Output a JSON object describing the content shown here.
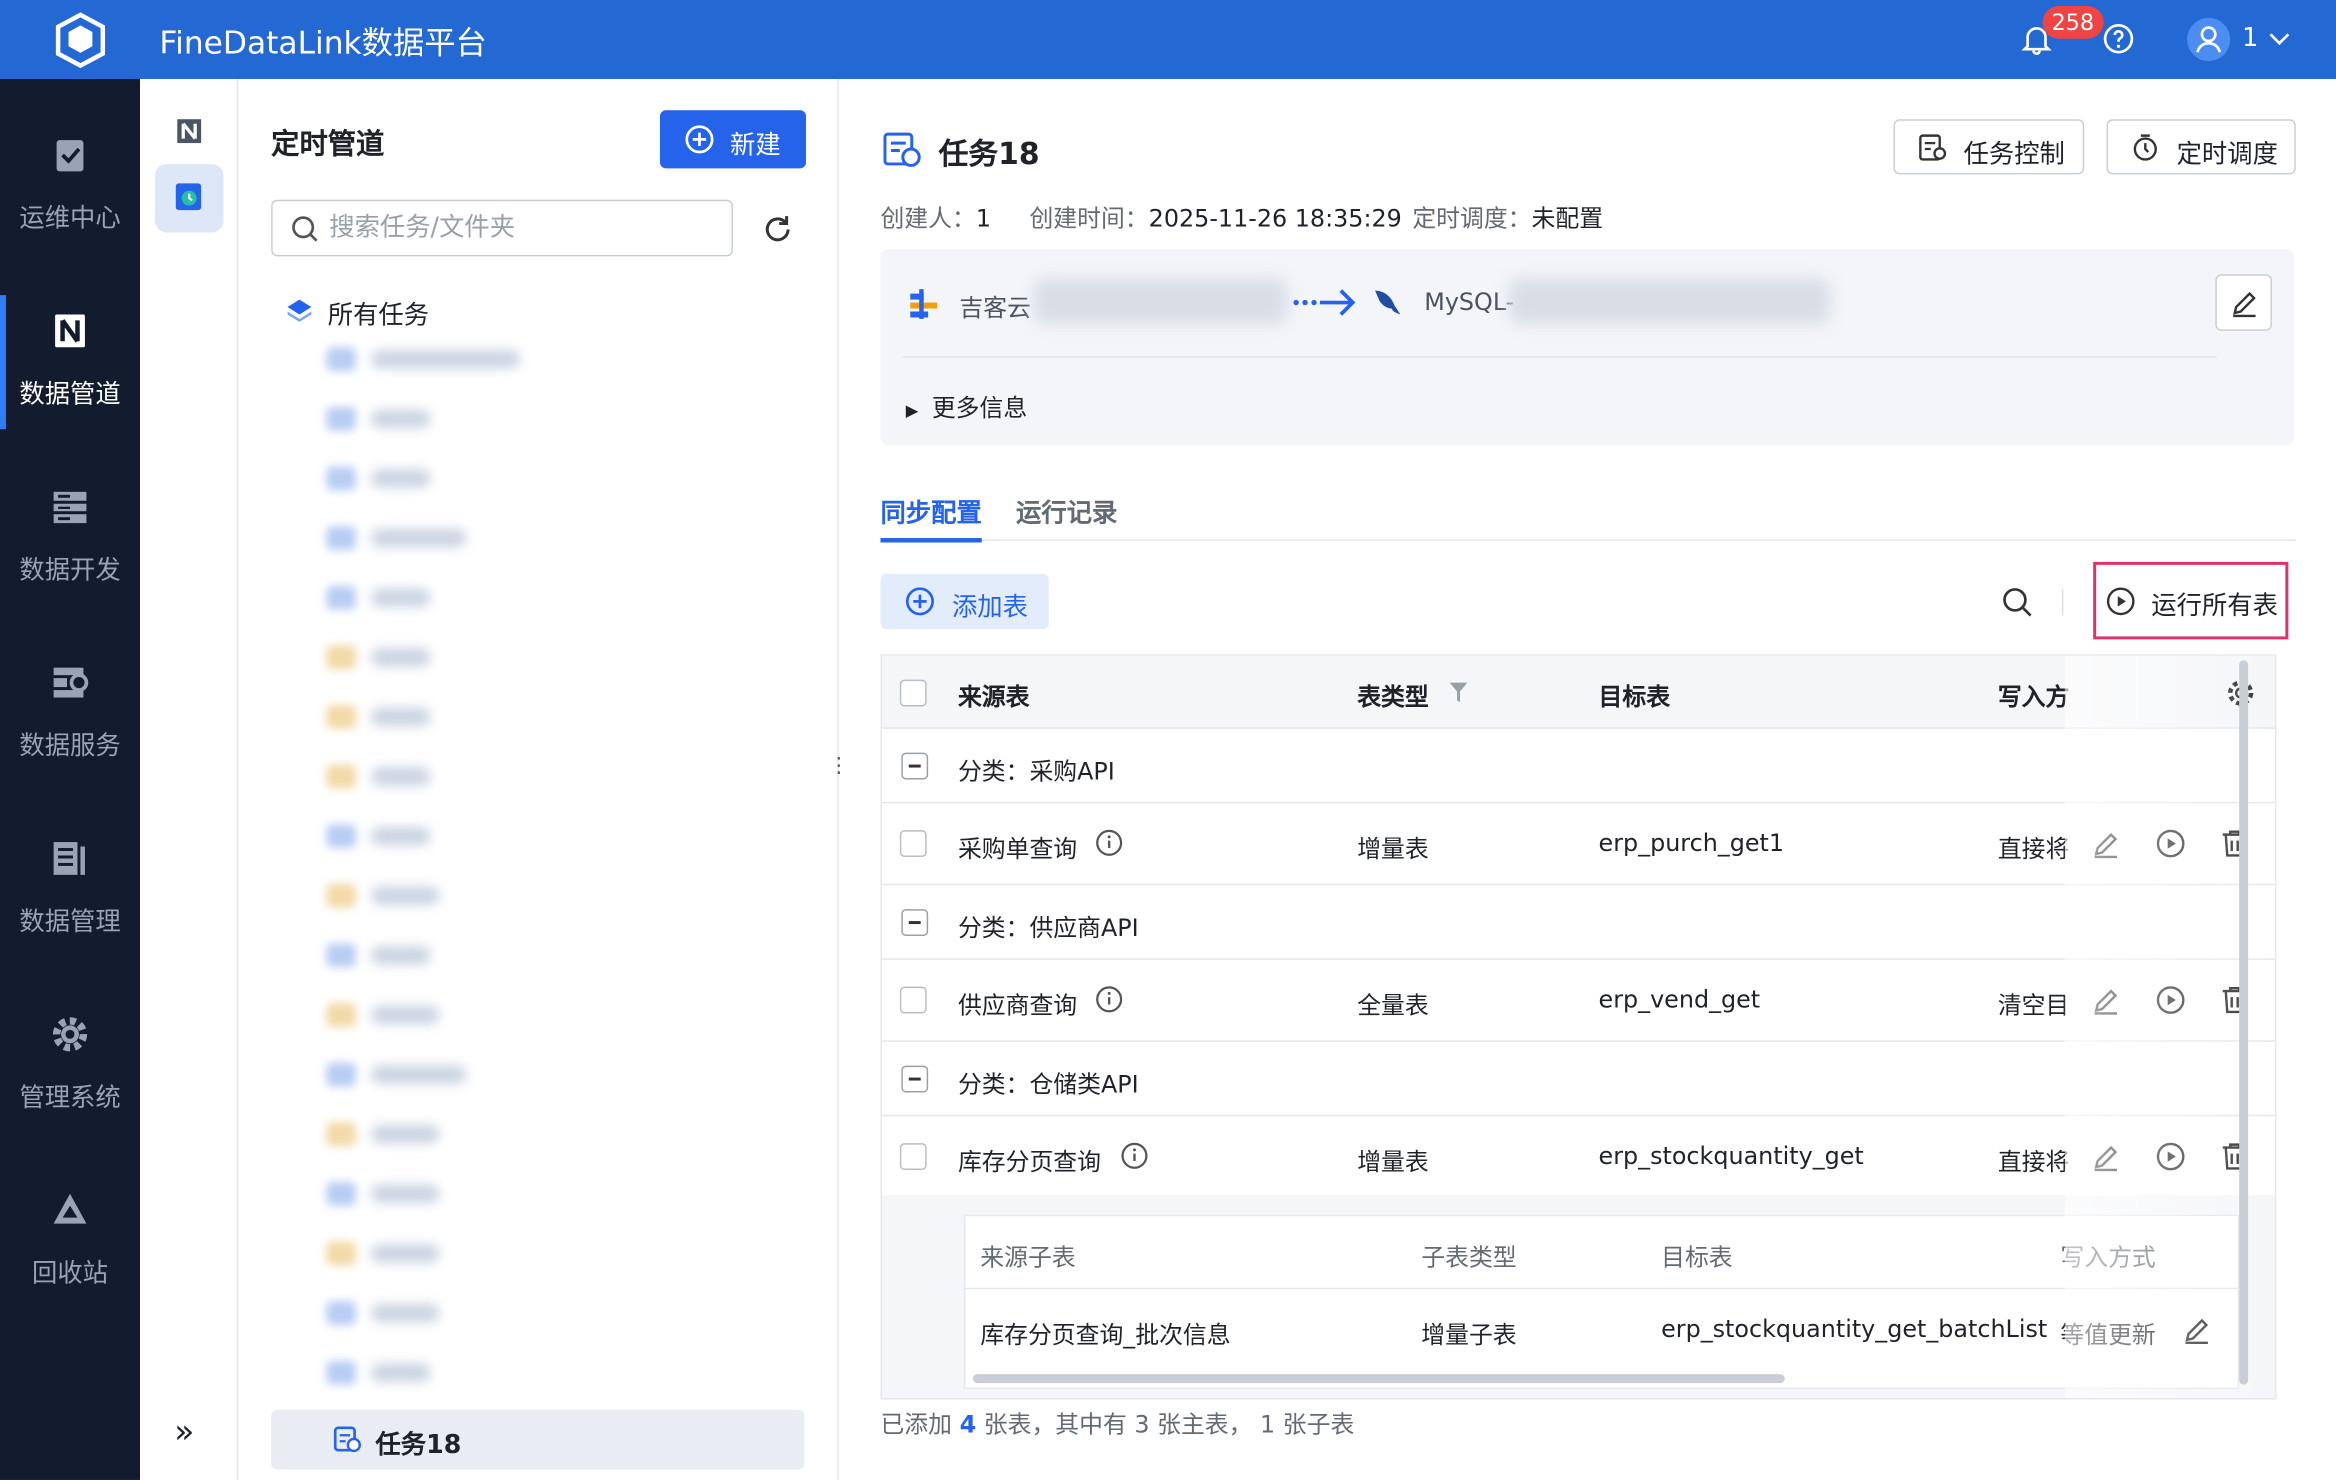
{
  "app": {
    "title": "FineDataLink数据平台",
    "notification_count": "258",
    "user": "1"
  },
  "nav": {
    "items": [
      {
        "label": "运维中心",
        "icon": "clipboard-check-icon"
      },
      {
        "label": "数据管道",
        "icon": "pipeline-icon"
      },
      {
        "label": "数据开发",
        "icon": "database-stack-icon"
      },
      {
        "label": "数据服务",
        "icon": "service-icon"
      },
      {
        "label": "数据管理",
        "icon": "data-manage-icon"
      },
      {
        "label": "管理系统",
        "icon": "gear-icon"
      },
      {
        "label": "回收站",
        "icon": "recycle-icon"
      }
    ],
    "active": "数据管道"
  },
  "tree": {
    "title": "定时管道",
    "new_button": "新建",
    "search_placeholder": "搜索任务/文件夹",
    "root": "所有任务",
    "selected_task": "任务18"
  },
  "task": {
    "title": "任务18",
    "task_control": "任务控制",
    "schedule": "定时调度",
    "creator_label": "创建人：",
    "creator": "1",
    "created_label": "创建时间：",
    "created": "2025-11-26 18:35:29",
    "schedule_label": "定时调度：",
    "schedule_value": "未配置",
    "source": "吉客云",
    "target": "MySQL-",
    "more_info": "更多信息"
  },
  "tabs": [
    "同步配置",
    "运行记录"
  ],
  "toolbar": {
    "add_table": "添加表",
    "run_all": "运行所有表"
  },
  "table": {
    "columns": [
      "来源表",
      "表类型",
      "目标表",
      "写入方"
    ],
    "groups": [
      {
        "label": "分类：采购API",
        "rows": [
          {
            "source": "采购单查询",
            "type": "增量表",
            "target": "erp_purch_get1",
            "write": "直接将"
          }
        ]
      },
      {
        "label": "分类：供应商API",
        "rows": [
          {
            "source": "供应商查询",
            "type": "全量表",
            "target": "erp_vend_get",
            "write": "清空目"
          }
        ]
      },
      {
        "label": "分类：仓储类API",
        "rows": [
          {
            "source": "库存分页查询",
            "type": "增量表",
            "target": "erp_stockquantity_get",
            "write": "直接将"
          }
        ]
      }
    ],
    "sub_columns": [
      "来源子表",
      "子表类型",
      "目标表",
      "写入方式"
    ],
    "sub_row": {
      "source": "库存分页查询_批次信息",
      "type": "增量子表",
      "target": "erp_stockquantity_get_batchList",
      "write": "等值更新"
    }
  },
  "summary": {
    "prefix": "已添加",
    "total": "4",
    "rest": "张表，其中有 3 张主表， 1 张子表"
  },
  "colors": {
    "brand": "#2468d4",
    "nav_bg": "#131b2e",
    "accent": "#2563eb",
    "highlight": "#e0306d"
  }
}
